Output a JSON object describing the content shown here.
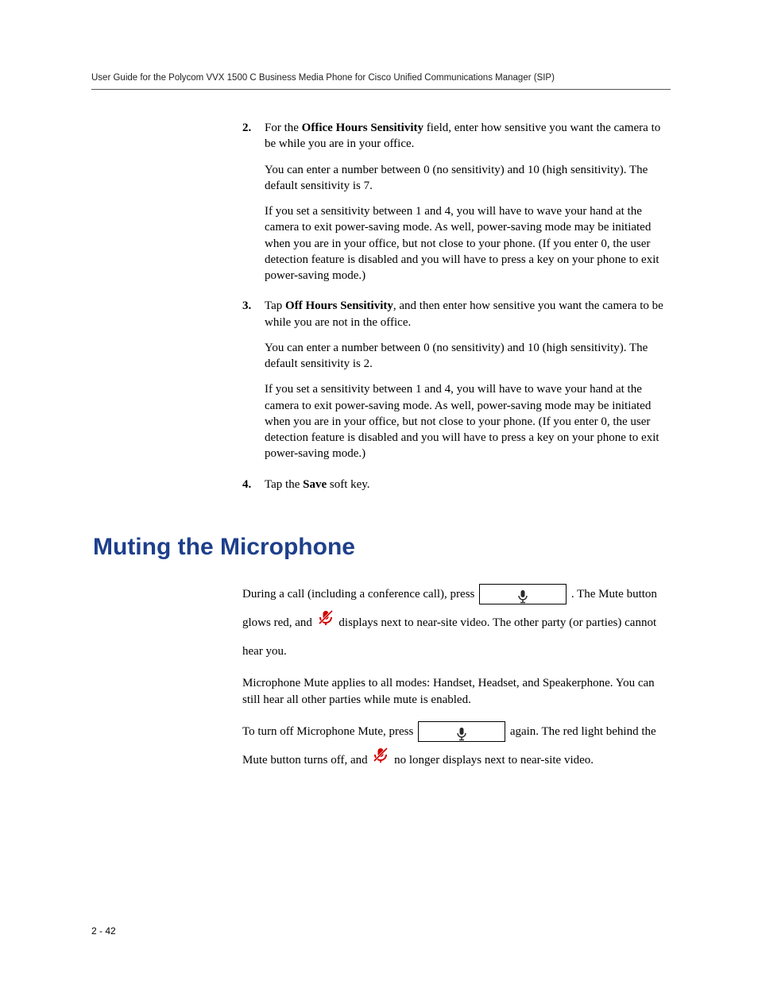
{
  "header": {
    "running_title": "User Guide for the Polycom VVX 1500 C Business Media Phone for Cisco Unified Communications Manager (SIP)"
  },
  "list": {
    "item2": {
      "num": "2.",
      "lead_a": "For the ",
      "bold_a": "Office Hours Sensitivity",
      "lead_b": " field, enter how sensitive you want the camera to be while you are in your office.",
      "para2": "You can enter a number between 0 (no sensitivity) and 10 (high sensitivity). The default sensitivity is 7.",
      "para3": "If you set a sensitivity between 1 and 4, you will have to wave your hand at the camera to exit power-saving mode. As well, power-saving mode may be initiated when you are in your office, but not close to your phone. (If you enter 0, the user detection feature is disabled and you will have to press a key on your phone to exit power-saving mode.)"
    },
    "item3": {
      "num": "3.",
      "lead_a": "Tap ",
      "bold_a": "Off Hours Sensitivity",
      "lead_b": ", and then enter how sensitive you want the camera to be while you are not in the office.",
      "para2": "You can enter a number between 0 (no sensitivity) and 10 (high sensitivity). The default sensitivity is 2.",
      "para3": "If you set a sensitivity between 1 and 4, you will have to wave your hand at the camera to exit power-saving mode. As well, power-saving mode may be initiated when you are in your office, but not close to your phone. (If you enter 0, the user detection feature is disabled and you will have to press a key on your phone to exit power-saving mode.)"
    },
    "item4": {
      "num": "4.",
      "lead_a": "Tap the ",
      "bold_a": "Save",
      "lead_b": " soft key."
    }
  },
  "section": {
    "heading": "Muting the Microphone",
    "p1_a": "During a call (including a conference call), press ",
    "p1_b": ". The Mute button glows red, and ",
    "p1_c": " displays next to near-site video. The other party (or parties) cannot hear you.",
    "p2": "Microphone Mute applies to all modes: Handset, Headset, and Speakerphone. You can still hear all other parties while mute is enabled.",
    "p3_a": "To turn off Microphone Mute, press ",
    "p3_b": " again. The red light behind the Mute button turns off, and ",
    "p3_c": " no longer displays next to near-site video."
  },
  "footer": {
    "page_num": "2 - 42"
  }
}
